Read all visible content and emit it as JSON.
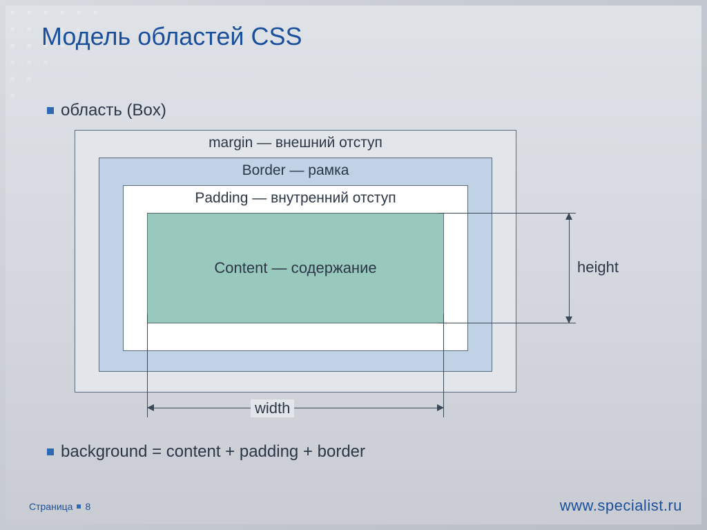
{
  "title": "Модель областей CSS",
  "bullets": {
    "box": "область (Box)",
    "background": "background = content + padding + border"
  },
  "diagram": {
    "margin_label": "margin — внешний отступ",
    "border_label": "Border — рамка",
    "padding_label": "Padding — внутренний отступ",
    "content_label": "Content — содержание",
    "width_label": "width",
    "height_label": "height"
  },
  "footer": {
    "page_word": "Страница",
    "page_number": "8",
    "site": "www.specialist.ru"
  },
  "colors": {
    "accent": "#1a4f9c",
    "margin_bg": "#e2e5ea",
    "border_bg": "#bfd2e6",
    "padding_bg": "#ffffff",
    "content_bg": "#99c8bd"
  }
}
